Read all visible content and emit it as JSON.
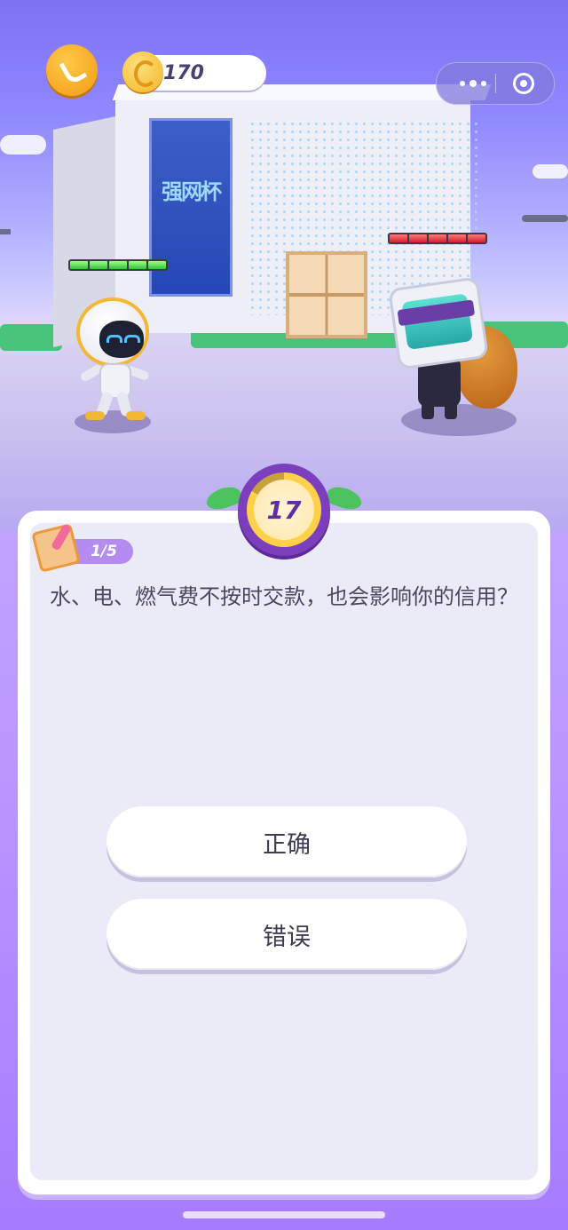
{
  "top_bar": {
    "home_icon": "home-return-icon",
    "coin_icon": "gold-coin-icon",
    "coins": "170",
    "more_icon": "more-dots-icon",
    "close_icon": "target-close-icon"
  },
  "battle": {
    "building_sign": "强网杯",
    "player_health": {
      "segments": 5,
      "filled": 5,
      "color": "#32c43a"
    },
    "enemy_health": {
      "segments": 5,
      "filled": 5,
      "color": "#d21f2b"
    }
  },
  "timer": {
    "seconds": "17",
    "accent": "#7b3fbd"
  },
  "quiz": {
    "progress": "1/5",
    "question": "水、电、燃气费不按时交款，也会影响你的信用？",
    "answers": [
      {
        "label": "正确"
      },
      {
        "label": "错误"
      }
    ]
  }
}
